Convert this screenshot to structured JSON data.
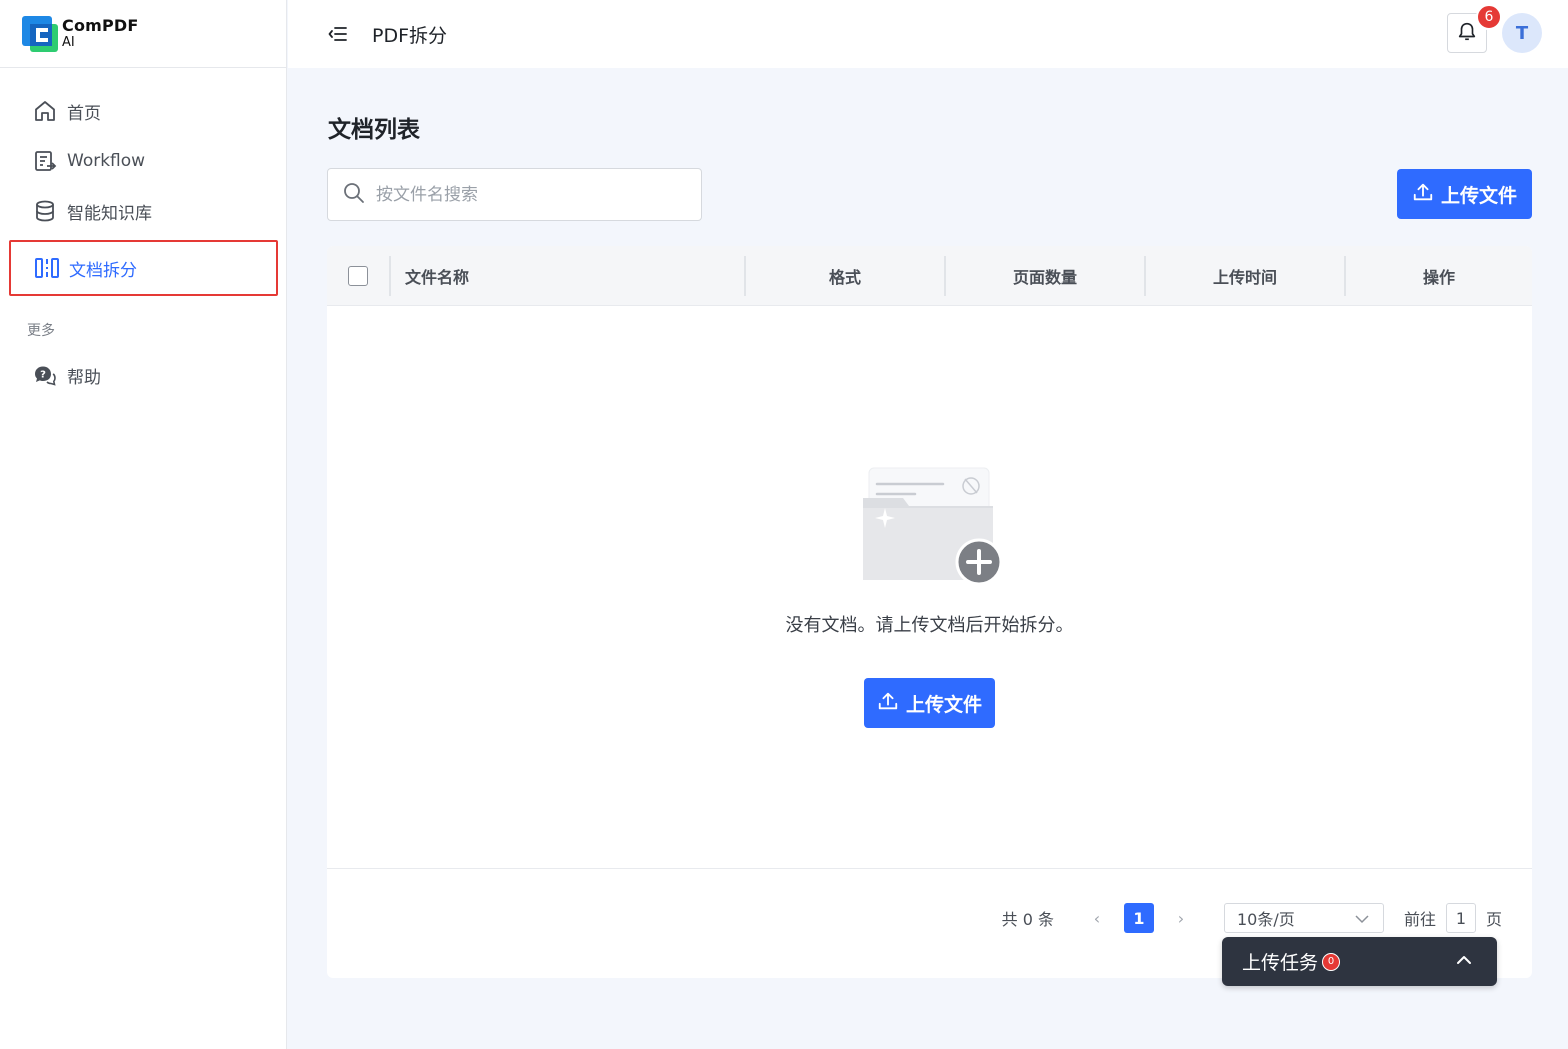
{
  "app": {
    "logo_line1": "ComPDF",
    "logo_line2": "AI",
    "brand_colors": {
      "primary": "#2f6bff",
      "danger": "#e53935",
      "logo_blue": "#1e88e5",
      "logo_green": "#2ecc71"
    }
  },
  "sidebar": {
    "items": [
      {
        "label": "首页",
        "icon": "home-icon"
      },
      {
        "label": "Workflow",
        "icon": "workflow-icon"
      },
      {
        "label": "智能知识库",
        "icon": "database-icon"
      },
      {
        "label": "文档拆分",
        "icon": "split-icon",
        "active": true
      }
    ],
    "section_more": "更多",
    "more_items": [
      {
        "label": "帮助",
        "icon": "help-chat-icon"
      }
    ]
  },
  "topbar": {
    "title": "PDF拆分",
    "notification_count": "6",
    "avatar_initial": "T"
  },
  "main": {
    "title": "文档列表",
    "search_placeholder": "按文件名搜索",
    "upload_label": "上传文件",
    "table": {
      "columns": [
        "文件名称",
        "格式",
        "页面数量",
        "上传时间",
        "操作"
      ],
      "rows": []
    },
    "empty": {
      "text": "没有文档。请上传文档后开始拆分。",
      "upload_label": "上传文件"
    },
    "pagination": {
      "total": "共 0 条",
      "current_page": "1",
      "page_size": "10条/页",
      "goto_label": "前往",
      "goto_value": "1",
      "page_suffix": "页"
    }
  },
  "upload_task": {
    "label": "上传任务",
    "count": "0"
  }
}
